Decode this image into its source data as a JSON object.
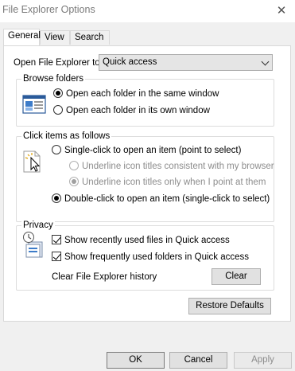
{
  "window": {
    "title": "File Explorer Options",
    "close_glyph": "✕"
  },
  "tabs": [
    {
      "label": "General",
      "active": true
    },
    {
      "label": "View",
      "active": false
    },
    {
      "label": "Search",
      "active": false
    }
  ],
  "open_explorer": {
    "label": "Open File Explorer to:",
    "value": "Quick access"
  },
  "browse_folders": {
    "label": "Browse folders",
    "options": [
      {
        "label": "Open each folder in the same window",
        "checked": true
      },
      {
        "label": "Open each folder in its own window",
        "checked": false
      }
    ]
  },
  "click_items": {
    "label": "Click items as follows",
    "single_click": "Single-click to open an item (point to select)",
    "underline_browser": "Underline icon titles consistent with my browser",
    "underline_point": "Underline icon titles only when I point at them",
    "double_click": "Double-click to open an item (single-click to select)"
  },
  "privacy": {
    "label": "Privacy",
    "recent_files": "Show recently used files in Quick access",
    "frequent_folders": "Show frequently used folders in Quick access",
    "clear_history_label": "Clear File Explorer history",
    "clear_button": "Clear"
  },
  "restore_defaults": "Restore Defaults",
  "footer": {
    "ok": "OK",
    "cancel": "Cancel",
    "apply": "Apply"
  }
}
